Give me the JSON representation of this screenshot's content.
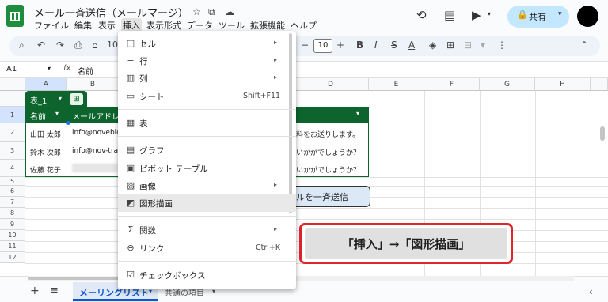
{
  "doc": {
    "title": "メール一斉送信（メールマージ）",
    "title_icons": [
      "star-icon",
      "move-to-folder-icon",
      "cloud-status-icon"
    ],
    "menus": [
      "ファイル",
      "編集",
      "表示",
      "挿入",
      "表示形式",
      "データ",
      "ツール",
      "拡張機能",
      "ヘルプ"
    ],
    "active_menu": "挿入",
    "share_label": "共有"
  },
  "toolbar": {
    "zoom_partial": "100",
    "font_size": "10",
    "minus": "−",
    "plus": "+",
    "bold": "B",
    "italic": "I",
    "strike": "S",
    "underline_a": "A"
  },
  "formula_bar": {
    "cell_ref": "A1",
    "fx": "fx",
    "value": "名前"
  },
  "grid": {
    "columns": [
      "A",
      "B",
      "C",
      "D",
      "E",
      "F",
      "G",
      "H"
    ],
    "rows": [
      "1",
      "2",
      "3",
      "4",
      "5",
      "6",
      "7",
      "8",
      "9",
      "10",
      "11",
      "12"
    ]
  },
  "table": {
    "name": "表_1",
    "headers": [
      "名前",
      "メールアドレ"
    ],
    "rows": [
      {
        "name": "山田 太郎",
        "email": "info@noveblo.",
        "d": "料をお送りします。"
      },
      {
        "name": "鈴木 次郎",
        "email": "info@nov-trave",
        "d": "いかがでしょうか？"
      },
      {
        "name": "佐藤 花子",
        "email": "",
        "d": "いかがでしょうか？"
      }
    ]
  },
  "send_button_label": "ルを一斉送信",
  "callout_text": "「挿入」→「図形描画」",
  "insert_menu": {
    "items": [
      {
        "icon": "□",
        "icon_name": "cell-icon",
        "label": "セル",
        "submenu": true
      },
      {
        "icon": "≡",
        "icon_name": "row-icon",
        "label": "行",
        "submenu": true
      },
      {
        "icon": "▥",
        "icon_name": "column-icon",
        "label": "列",
        "submenu": true
      },
      {
        "icon": "▭",
        "icon_name": "sheet-icon",
        "label": "シート",
        "shortcut": "Shift+F11"
      },
      {
        "icon": "▦",
        "icon_name": "table-icon",
        "label": "表"
      },
      {
        "icon": "▤",
        "icon_name": "chart-icon",
        "label": "グラフ"
      },
      {
        "icon": "▣",
        "icon_name": "pivot-table-icon",
        "label": "ピボット テーブル"
      },
      {
        "icon": "▨",
        "icon_name": "image-icon",
        "label": "画像",
        "submenu": true
      },
      {
        "icon": "◩",
        "icon_name": "drawing-icon",
        "label": "図形描画"
      },
      {
        "icon": "Σ",
        "icon_name": "function-icon",
        "label": "関数",
        "submenu": true
      },
      {
        "icon": "⊖",
        "icon_name": "link-icon",
        "label": "リンク",
        "shortcut": "Ctrl+K"
      },
      {
        "icon": "☑",
        "icon_name": "checkbox-icon",
        "label": "チェックボックス"
      }
    ]
  },
  "sheet_tabs": [
    "メーリングリスト",
    "共通の項目"
  ],
  "submenu_arrow": "▸",
  "tab_caret": "▾"
}
